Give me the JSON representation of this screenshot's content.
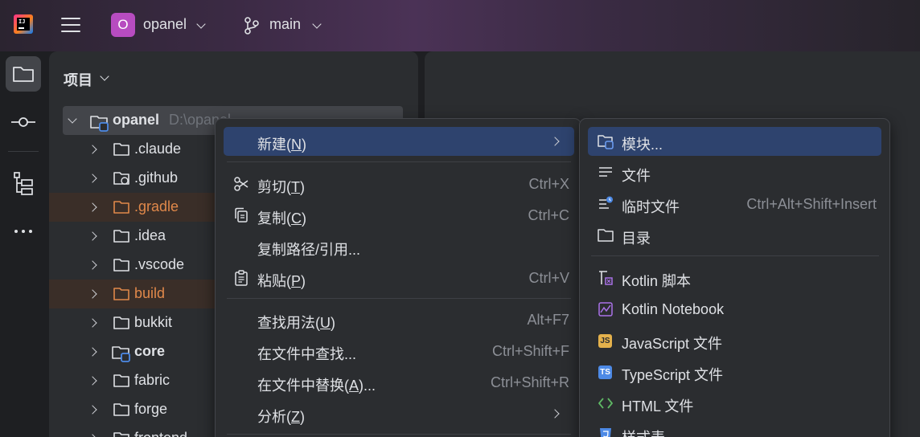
{
  "titlebar": {
    "project_badge": "O",
    "project_name": "opanel",
    "branch_name": "main"
  },
  "toolstrip": {
    "icons": [
      "folder-icon",
      "commit-icon",
      "structure-icon",
      "more-icon"
    ]
  },
  "project_panel": {
    "title": "项目",
    "root": {
      "name": "opanel",
      "path": "D:\\opanel"
    },
    "items": [
      {
        "name": ".claude",
        "type": "folder"
      },
      {
        "name": ".github",
        "type": "folder-github"
      },
      {
        "name": ".gradle",
        "type": "folder-excluded"
      },
      {
        "name": ".idea",
        "type": "folder"
      },
      {
        "name": ".vscode",
        "type": "folder"
      },
      {
        "name": "build",
        "type": "folder-excluded"
      },
      {
        "name": "bukkit",
        "type": "folder"
      },
      {
        "name": "core",
        "type": "module"
      },
      {
        "name": "fabric",
        "type": "folder"
      },
      {
        "name": "forge",
        "type": "folder"
      },
      {
        "name": "frontend",
        "type": "folder"
      }
    ]
  },
  "context_menu": {
    "new": {
      "label": "新建(",
      "mnemonic": "N",
      "suffix": ")"
    },
    "cut": {
      "label": "剪切(",
      "mnemonic": "T",
      "suffix": ")",
      "shortcut": "Ctrl+X"
    },
    "copy": {
      "label": "复制(",
      "mnemonic": "C",
      "suffix": ")",
      "shortcut": "Ctrl+C"
    },
    "copy_path": {
      "label": "复制路径/引用..."
    },
    "paste": {
      "label": "粘贴(",
      "mnemonic": "P",
      "suffix": ")",
      "shortcut": "Ctrl+V"
    },
    "find_usages": {
      "label": "查找用法(",
      "mnemonic": "U",
      "suffix": ")",
      "shortcut": "Alt+F7"
    },
    "find_in_files": {
      "label": "在文件中查找...",
      "shortcut": "Ctrl+Shift+F"
    },
    "replace_in_files": {
      "label": "在文件中替换(",
      "mnemonic": "A",
      "suffix": ")...",
      "shortcut": "Ctrl+Shift+R"
    },
    "analyze": {
      "label": "分析(",
      "mnemonic": "Z",
      "suffix": ")"
    }
  },
  "new_submenu": {
    "module": "模块...",
    "file": "文件",
    "scratch": {
      "label": "临时文件",
      "shortcut": "Ctrl+Alt+Shift+Insert"
    },
    "directory": "目录",
    "kotlin_script": "Kotlin 脚本",
    "kotlin_notebook": "Kotlin Notebook",
    "javascript_file": "JavaScript 文件",
    "typescript_file": "TypeScript 文件",
    "html_file": "HTML 文件",
    "stylesheet": "样式表",
    "js_badge": "JS",
    "ts_badge": "TS"
  },
  "colors": {
    "accent_selection": "#2e436e",
    "excluded_folder": "#e0884a",
    "project_badge": "#b74cc0"
  }
}
